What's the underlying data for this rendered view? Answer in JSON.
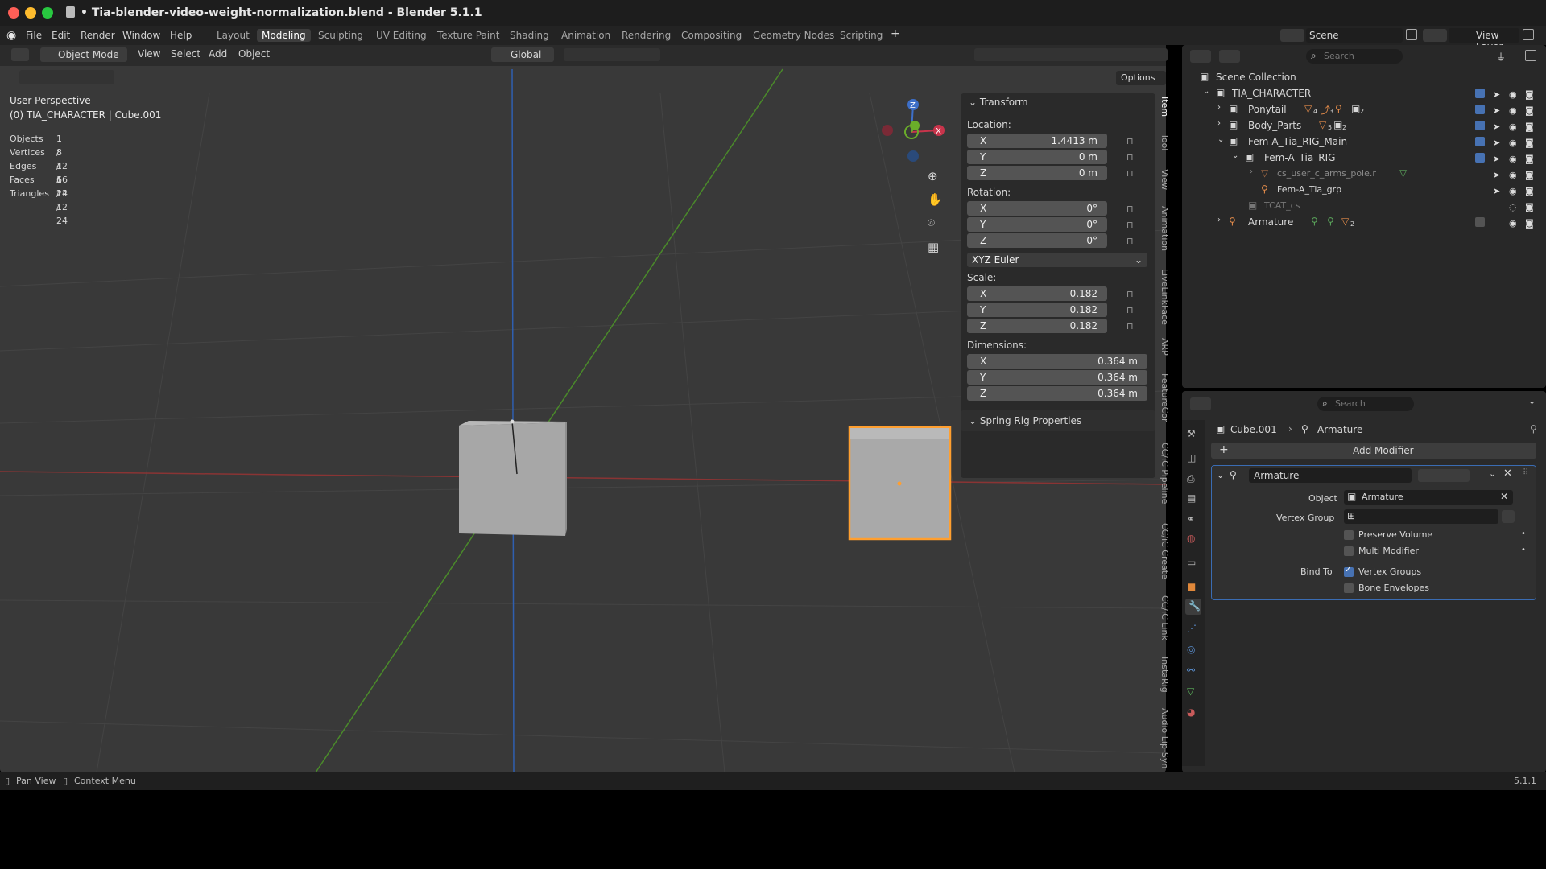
{
  "window": {
    "title": "• Tia-blender-video-weight-normalization.blend - Blender 5.1.1"
  },
  "menu": [
    "File",
    "Edit",
    "Render",
    "Window",
    "Help"
  ],
  "workspaces": [
    "Layout",
    "Modeling",
    "Sculpting",
    "UV Editing",
    "Texture Paint",
    "Shading",
    "Animation",
    "Rendering",
    "Compositing",
    "Geometry Nodes",
    "Scripting"
  ],
  "active_workspace": "Modeling",
  "scene": {
    "name": "Scene",
    "view_layer": "View Layer"
  },
  "viewport_header": {
    "mode": "Object Mode",
    "view": "View",
    "select": "Select",
    "add": "Add",
    "object": "Object",
    "orientation": "Global",
    "options": "Options"
  },
  "overlay": {
    "perspective": "User Perspective",
    "collection": "(0) TIA_CHARACTER | Cube.001",
    "stats": [
      {
        "k": "Objects",
        "v": "1 / 4"
      },
      {
        "k": "Vertices",
        "v": "8 / 16"
      },
      {
        "k": "Edges",
        "v": "12 / 24"
      },
      {
        "k": "Faces",
        "v": "6 / 12"
      },
      {
        "k": "Triangles",
        "v": "12 / 24"
      }
    ]
  },
  "npanel": {
    "transform": "Transform",
    "location": "Location:",
    "loc": {
      "x": "1.4413 m",
      "y": "0 m",
      "z": "0 m"
    },
    "rotation": "Rotation:",
    "rot": {
      "x": "0°",
      "y": "0°",
      "z": "0°"
    },
    "rot_mode": "XYZ Euler",
    "scale": "Scale:",
    "scl": {
      "x": "0.182",
      "y": "0.182",
      "z": "0.182"
    },
    "dimensions": "Dimensions:",
    "dim": {
      "x": "0.364 m",
      "y": "0.364 m",
      "z": "0.364 m"
    },
    "spring": "Spring Rig Properties",
    "axes": {
      "x": "X",
      "y": "Y",
      "z": "Z"
    }
  },
  "side_tabs": [
    "Item",
    "Tool",
    "View",
    "Animation",
    "LiveLinkFace",
    "ARP",
    "FeatureCor",
    "CC/iC Pipeline",
    "CC/iC Create",
    "CC/iC Link",
    "InstaRig",
    "Audio Lip-Syn"
  ],
  "outliner": {
    "search": "Search",
    "root": "Scene Collection",
    "rows": [
      "TIA_CHARACTER",
      "Ponytail",
      "Body_Parts",
      "Fem-A_Tia_RIG_Main",
      "Fem-A_Tia_RIG",
      "cs_user_c_arms_pole.r",
      "Fem-A_Tia_grp",
      "TCAT_cs",
      "Armature"
    ],
    "badges": {
      "ponytail_a": "4",
      "ponytail_b": "3",
      "ponytail_c": "2",
      "body_a": "5",
      "body_b": "2",
      "arm_a": "2"
    }
  },
  "properties": {
    "search": "Search",
    "breadcrumb_obj": "Cube.001",
    "breadcrumb_mod": "Armature",
    "add_modifier": "Add Modifier",
    "modifier": {
      "name": "Armature",
      "object_label": "Object",
      "object_value": "Armature",
      "vg_label": "Vertex Group",
      "preserve": "Preserve Volume",
      "multi": "Multi Modifier",
      "bind_to": "Bind To",
      "vgroups": "Vertex Groups",
      "envelopes": "Bone Envelopes"
    }
  },
  "statusbar": {
    "pan": "Pan View",
    "context": "Context Menu",
    "version": "5.1.1"
  }
}
